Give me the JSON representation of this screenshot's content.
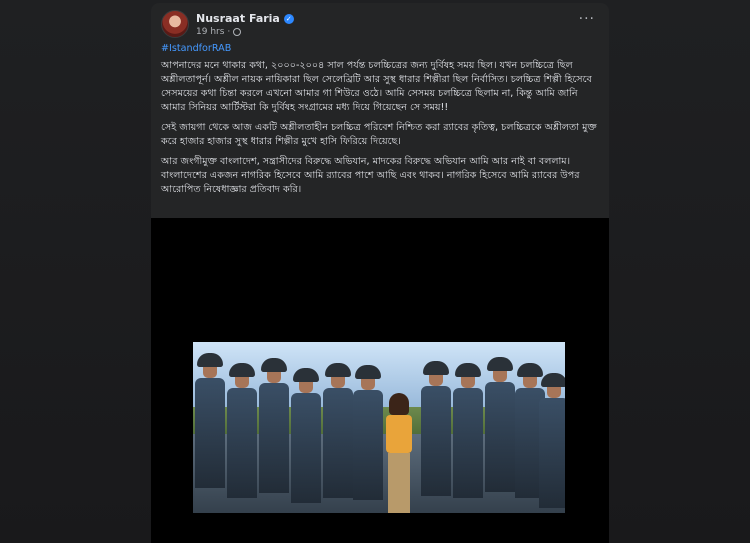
{
  "post": {
    "author": "Nusraat Faria",
    "time": "19 hrs",
    "time_separator": "·",
    "hashtag": "#IstandforRAB",
    "paragraphs": [
      "আপনাদের মনে থাকার কথা, ২০০০-২০০৪ সাল পর্যন্ত চলচ্চিত্রের জন্য দুর্বিষহ সময় ছিল। যখন চলচ্চিত্রে ছিল অশ্লীলতাপূর্ন। অশ্লীল নায়ক নায়িকারা ছিল সেলেব্রিটি আর সুস্থ ধারার শিল্পীরা ছিল নির্বাসিত। চলচ্চিত্র শিল্পী হিসেবে সেসময়ের কথা চিন্তা করলে এখনো আমার গা শিউরে ওঠে। আমি সেসময় চলচ্চিত্রে ছিলাম না, কিন্তু আমি জানি আমার সিনিয়র আর্টিস্টরা কি দুর্বিষহ সংগ্রামের মধ্য দিয়ে গিয়েছেন সে সময়!!",
      "সেই জায়গা থেকে আজ একটি অশ্লীলতাহীন চলচ্চিত্র পরিবেশ নিশ্চিত করা র‍্যাবের কৃতিত্ব, চলচ্চিত্রকে অশ্লীলতা মুক্ত করে হাজার হাজার সুস্থ ধারার শিল্পীর মুখে হাসি ফিরিয়ে দিয়েছে।",
      "আর জংগীমুক্ত বাংলাদেশ, সন্ত্রাসীদের বিরুদ্ধে অভিযান, মাদকের বিরুদ্ধে অভিযান আমি আর নাই বা বললাম। বাংলাদেশের একজন নাগরিক হিসেবে আমি র‍্যাবের পাশে আছি এবং থাকব। নাগরিক হিসেবে আমি র‍্যাবের উপর আরোপিত নিষেধাজ্ঞার প্রতিবাদ করি।"
    ]
  },
  "icons": {
    "more": "three-dots",
    "verified": "check-badge",
    "audience": "globe"
  },
  "colors": {
    "page_bg": "#1c1d1f",
    "card_bg": "#242526",
    "hashtag": "#4599ff",
    "verified": "#2d88ff"
  }
}
